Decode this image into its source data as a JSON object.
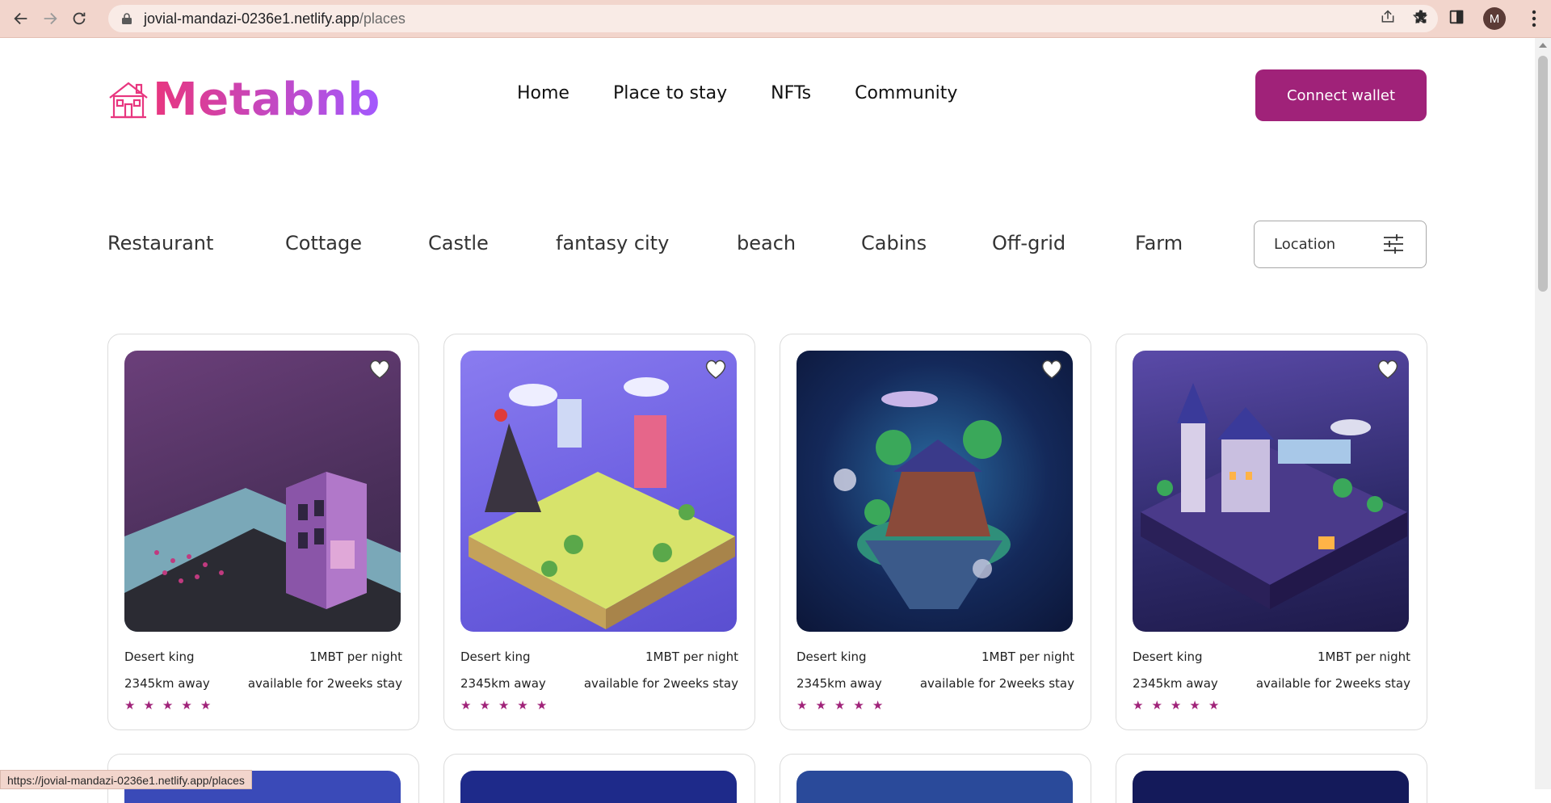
{
  "browser": {
    "url_host": "jovial-mandazi-0236e1.netlify.app",
    "url_path": "/places",
    "avatar_letter": "M",
    "status_url": "https://jovial-mandazi-0236e1.netlify.app/places"
  },
  "header": {
    "logo_text": "Metabnb",
    "nav": [
      "Home",
      "Place to stay",
      "NFTs",
      "Community"
    ],
    "connect_label": "Connect wallet"
  },
  "categories": [
    "Restaurant",
    "Cottage",
    "Castle",
    "fantasy city",
    "beach",
    "Cabins",
    "Off-grid",
    "Farm"
  ],
  "location_label": "Location",
  "cards": [
    {
      "title": "Desert king",
      "price": "1MBT per night",
      "distance": "2345km away",
      "availability": "available for 2weeks stay",
      "rating": 5,
      "theme": "purple-house"
    },
    {
      "title": "Desert king",
      "price": "1MBT per night",
      "distance": "2345km away",
      "availability": "available for 2weeks stay",
      "rating": 5,
      "theme": "fantasy-city"
    },
    {
      "title": "Desert king",
      "price": "1MBT per night",
      "distance": "2345km away",
      "availability": "available for 2weeks stay",
      "rating": 5,
      "theme": "floating-island"
    },
    {
      "title": "Desert king",
      "price": "1MBT per night",
      "distance": "2345km away",
      "availability": "available for 2weeks stay",
      "rating": 5,
      "theme": "castle-night"
    }
  ],
  "colors": {
    "accent": "#a02279",
    "logo_start": "#e8367f",
    "logo_end": "#a259ff"
  }
}
